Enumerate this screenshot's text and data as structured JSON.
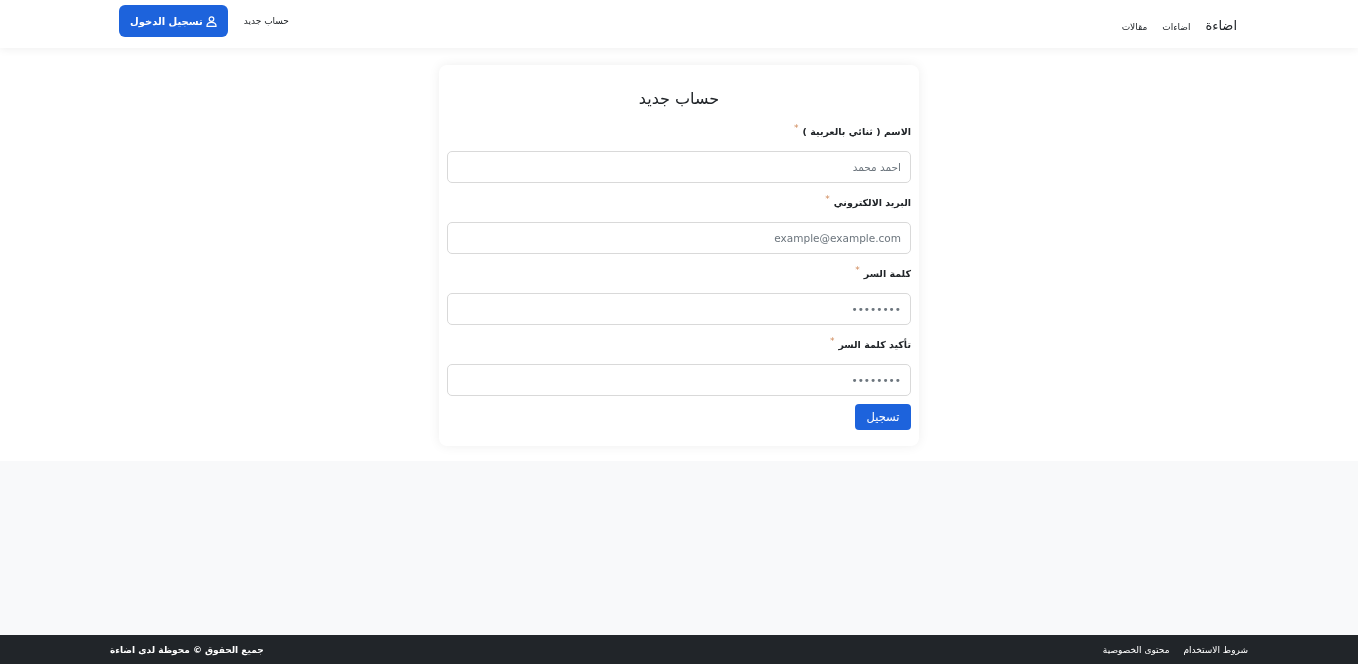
{
  "navbar": {
    "brand": "اضاءة",
    "links": [
      "اضاءات",
      "مقالات"
    ],
    "signup_link": "حساب جديد",
    "login_button": "تسجيل الدخول"
  },
  "form": {
    "title": "حساب جديد",
    "fields": [
      {
        "label": "الاسم ( ثنائي بالعربية )",
        "required_mark": "*",
        "placeholder": "احمد محمد"
      },
      {
        "label": "البريد الالكتروني",
        "required_mark": "*",
        "placeholder": "example@example.com"
      },
      {
        "label": "كلمة السر",
        "required_mark": "*",
        "placeholder": "••••••••"
      },
      {
        "label": "تأكيد كلمة السر",
        "required_mark": "*",
        "placeholder": "••••••••"
      }
    ],
    "submit_button": "تسجيل"
  },
  "footer": {
    "copyright": "جميع الحقوق © محوظة لدى اضاءة",
    "links": [
      "شروط الاستخدام",
      "محتوى الخصوصية"
    ]
  }
}
